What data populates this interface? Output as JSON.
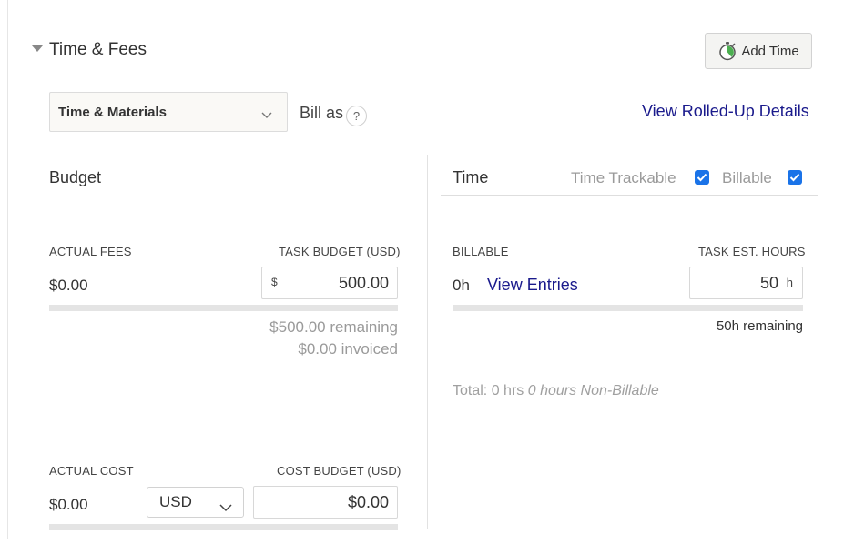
{
  "section": {
    "title": "Time & Fees"
  },
  "toolbar": {
    "add_time_label": "Add Time"
  },
  "billing": {
    "bill_type": "Time & Materials",
    "bill_as_label": "Bill as",
    "help_glyph": "?",
    "rolled_up_link": "View Rolled-Up Details"
  },
  "budget": {
    "header": "Budget",
    "actual_fees_label": "ACTUAL FEES",
    "actual_fees_value": "$0.00",
    "task_budget_label": "TASK BUDGET (USD)",
    "task_budget_prefix": "$",
    "task_budget_value": "500.00",
    "remaining": "$500.00 remaining",
    "invoiced": "$0.00 invoiced",
    "actual_cost_label": "ACTUAL COST",
    "actual_cost_value": "$0.00",
    "currency": "USD",
    "cost_budget_label": "COST BUDGET (USD)",
    "cost_budget_value": "$0.00"
  },
  "time": {
    "header": "Time",
    "trackable_label": "Time Trackable",
    "trackable_checked": true,
    "billable_label": "Billable",
    "billable_checked": true,
    "billable_caption": "BILLABLE",
    "billable_value": "0h",
    "view_entries": "View Entries",
    "est_hours_label": "TASK EST. HOURS",
    "est_hours_value": "50",
    "est_hours_unit": "h",
    "remaining": "50h remaining",
    "total_prefix": "Total: 0 hrs",
    "total_nonbillable": "0 hours Non-Billable"
  },
  "colors": {
    "link": "#1a1a8c",
    "checkbox": "#1a73e8",
    "muted": "#9a9a9a"
  },
  "icons": [
    "chevron-down-icon",
    "stopwatch-icon",
    "help-icon",
    "checkmark-icon"
  ]
}
